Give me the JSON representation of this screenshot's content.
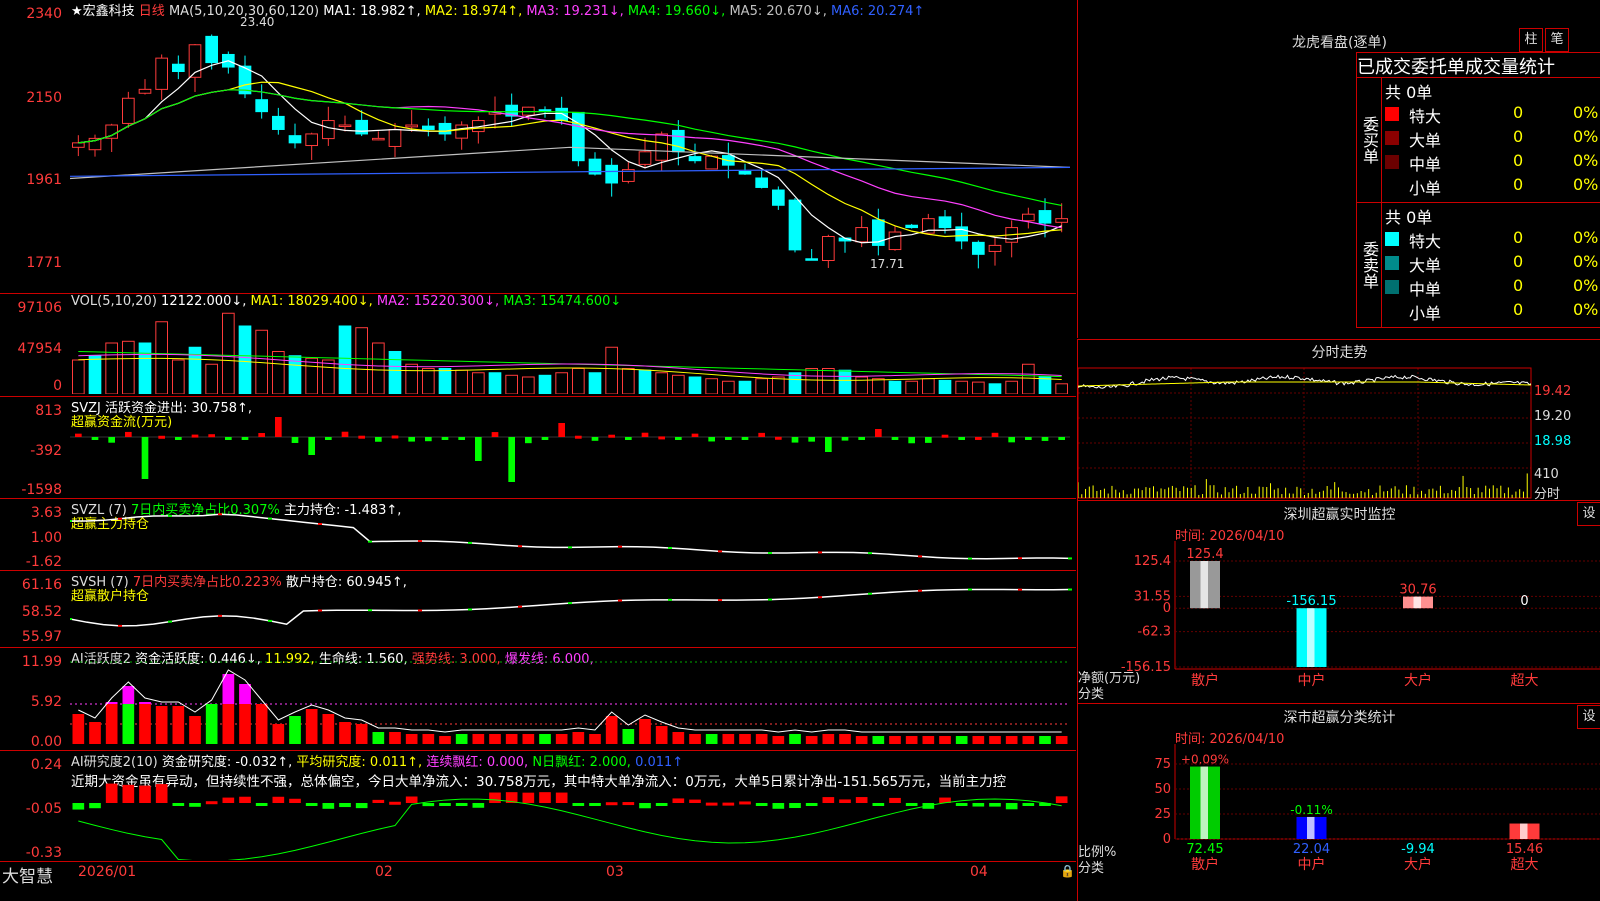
{
  "main": {
    "stock_name": "★宏鑫科技",
    "period": "日线",
    "ma_params": "MA(5,10,20,30,60,120)",
    "ma_values": [
      {
        "label": "MA1: 18.982↑,",
        "color": "#ffffff"
      },
      {
        "label": "MA2: 18.974↑,",
        "color": "#ffff00"
      },
      {
        "label": "MA3: 19.231↓,",
        "color": "#ff40ff"
      },
      {
        "label": "MA4: 19.660↓,",
        "color": "#00ff00"
      },
      {
        "label": "MA5: 20.670↓,",
        "color": "#c0c0c0"
      },
      {
        "label": "MA6: 20.274↑",
        "color": "#3060ff"
      }
    ],
    "y_labels": [
      "2340",
      "2150",
      "1961",
      "1771"
    ],
    "high_mark": "23.40",
    "low_mark": "17.71"
  },
  "vol": {
    "header_prefix": "VOL(5,10,20)",
    "vol_value": "12122.000↓,",
    "ma1": "MA1: 18029.400↓,",
    "ma2": "MA2: 15220.300↓,",
    "ma3": "MA3: 15474.600↓",
    "y_labels": [
      "97106",
      "47954",
      "0"
    ]
  },
  "svzj": {
    "header": "SVZJ  活跃资金进出: 30.758↑,",
    "sub": "超赢资金流(万元)",
    "y_labels": [
      "813",
      "-392",
      "-1598"
    ]
  },
  "svzl": {
    "name": "SVZL (7)",
    "ratio": "7日内买卖净占比0.307%",
    "hold": "主力持仓: -1.483↑,",
    "sub": "超赢主力持仓",
    "y_labels": [
      "3.63",
      "1.00",
      "-1.62"
    ]
  },
  "svsh": {
    "name": "SVSH (7)",
    "ratio": "7日内买卖净占比0.223%",
    "hold": "散户持仓: 60.945↑,",
    "sub": "超赢散户持仓",
    "y_labels": [
      "61.16",
      "58.52",
      "55.97"
    ]
  },
  "ai2": {
    "name": "AI活跃度2",
    "active": "资金活跃度: 0.446↓,",
    "v2": "11.992,",
    "life": "生命线: 1.560,",
    "strong": "强势线: 3.000,",
    "burst": "爆发线: 6.000,",
    "y_labels": [
      "11.99",
      "5.92",
      "0.00"
    ]
  },
  "ai_research": {
    "name": "AI研究度2(10)",
    "research": "资金研究度: -0.032↑,",
    "avg": "平均研究度: 0.011↑,",
    "cont": "连续飘红: 0.000,",
    "nday": "N日飘红: 2.000,",
    "last": "0.011↑",
    "comment": "近期大资金虽有异动，但持续性不强，总体偏空，今日大单净流入：30.758万元，其中特大单净流入：0万元，大单5日累计净出-151.565万元，当前主力控",
    "y_labels": [
      "0.24",
      "-0.05",
      "-0.33"
    ]
  },
  "xaxis": {
    "brand": "大智慧",
    "labels": [
      "2026/01",
      "02",
      "03",
      "04"
    ]
  },
  "dragon": {
    "title": "龙虎看盘(逐单)",
    "btn_bar": "柱",
    "btn_bi": "笔",
    "header": "已成交委托单成交量统计",
    "buy_label": "委买单",
    "sell_label": "委卖单",
    "buy_total": "共 0单",
    "sell_total": "共 0单",
    "buy_rows": [
      {
        "name": "特大",
        "count": "0",
        "pct": "0%",
        "color": "#ff0000"
      },
      {
        "name": "大单",
        "count": "0",
        "pct": "0%",
        "color": "#8b0000"
      },
      {
        "name": "中单",
        "count": "0",
        "pct": "0%",
        "color": "#6b0000"
      },
      {
        "name": "小单",
        "count": "0",
        "pct": "0%",
        "color": ""
      }
    ],
    "sell_rows": [
      {
        "name": "特大",
        "count": "0",
        "pct": "0%",
        "color": "#00ffff"
      },
      {
        "name": "大单",
        "count": "0",
        "pct": "0%",
        "color": "#008b8b"
      },
      {
        "name": "中单",
        "count": "0",
        "pct": "0%",
        "color": "#007070"
      },
      {
        "name": "小单",
        "count": "0",
        "pct": "0%",
        "color": ""
      }
    ]
  },
  "intraday": {
    "title": "分时走势",
    "y_labels": [
      "19.42",
      "19.20",
      "18.98"
    ],
    "vol_label": "410",
    "vol_unit": "分时"
  },
  "sz_monitor": {
    "title": "深圳超赢实时监控",
    "set": "设",
    "time": "时间: 2026/04/10",
    "y_labels": [
      "125.4",
      "31.55",
      "0",
      "-62.3",
      "-156.15"
    ],
    "unit": "净额(万元)",
    "cat_label": "分类",
    "categories": [
      "散户",
      "中户",
      "大户",
      "超大"
    ],
    "values": [
      125.4,
      -156.15,
      30.76,
      0
    ],
    "value_labels": [
      "125.4",
      "-156.15",
      "30.76",
      "0"
    ]
  },
  "sz_class": {
    "title": "深市超赢分类统计",
    "set": "设",
    "time": "时间: 2026/04/10",
    "y_labels": [
      "75",
      "50",
      "25",
      "0"
    ],
    "unit": "比例%",
    "cat_label": "分类",
    "categories": [
      "散户",
      "中户",
      "大户",
      "超大"
    ],
    "values": [
      72.45,
      22.04,
      -9.94,
      15.46
    ],
    "value_labels": [
      "72.45",
      "22.04",
      "-9.94",
      "15.46"
    ],
    "delta_labels": [
      "+0.09%",
      "-0.11%",
      "",
      ""
    ]
  },
  "chart_data": {
    "type": "bar",
    "title": "深圳超赢实时监控",
    "categories": [
      "散户",
      "中户",
      "大户",
      "超大"
    ],
    "series": [
      {
        "name": "净额(万元)",
        "values": [
          125.4,
          -156.15,
          30.76,
          0
        ]
      }
    ],
    "ylim": [
      -156.15,
      125.4
    ]
  }
}
